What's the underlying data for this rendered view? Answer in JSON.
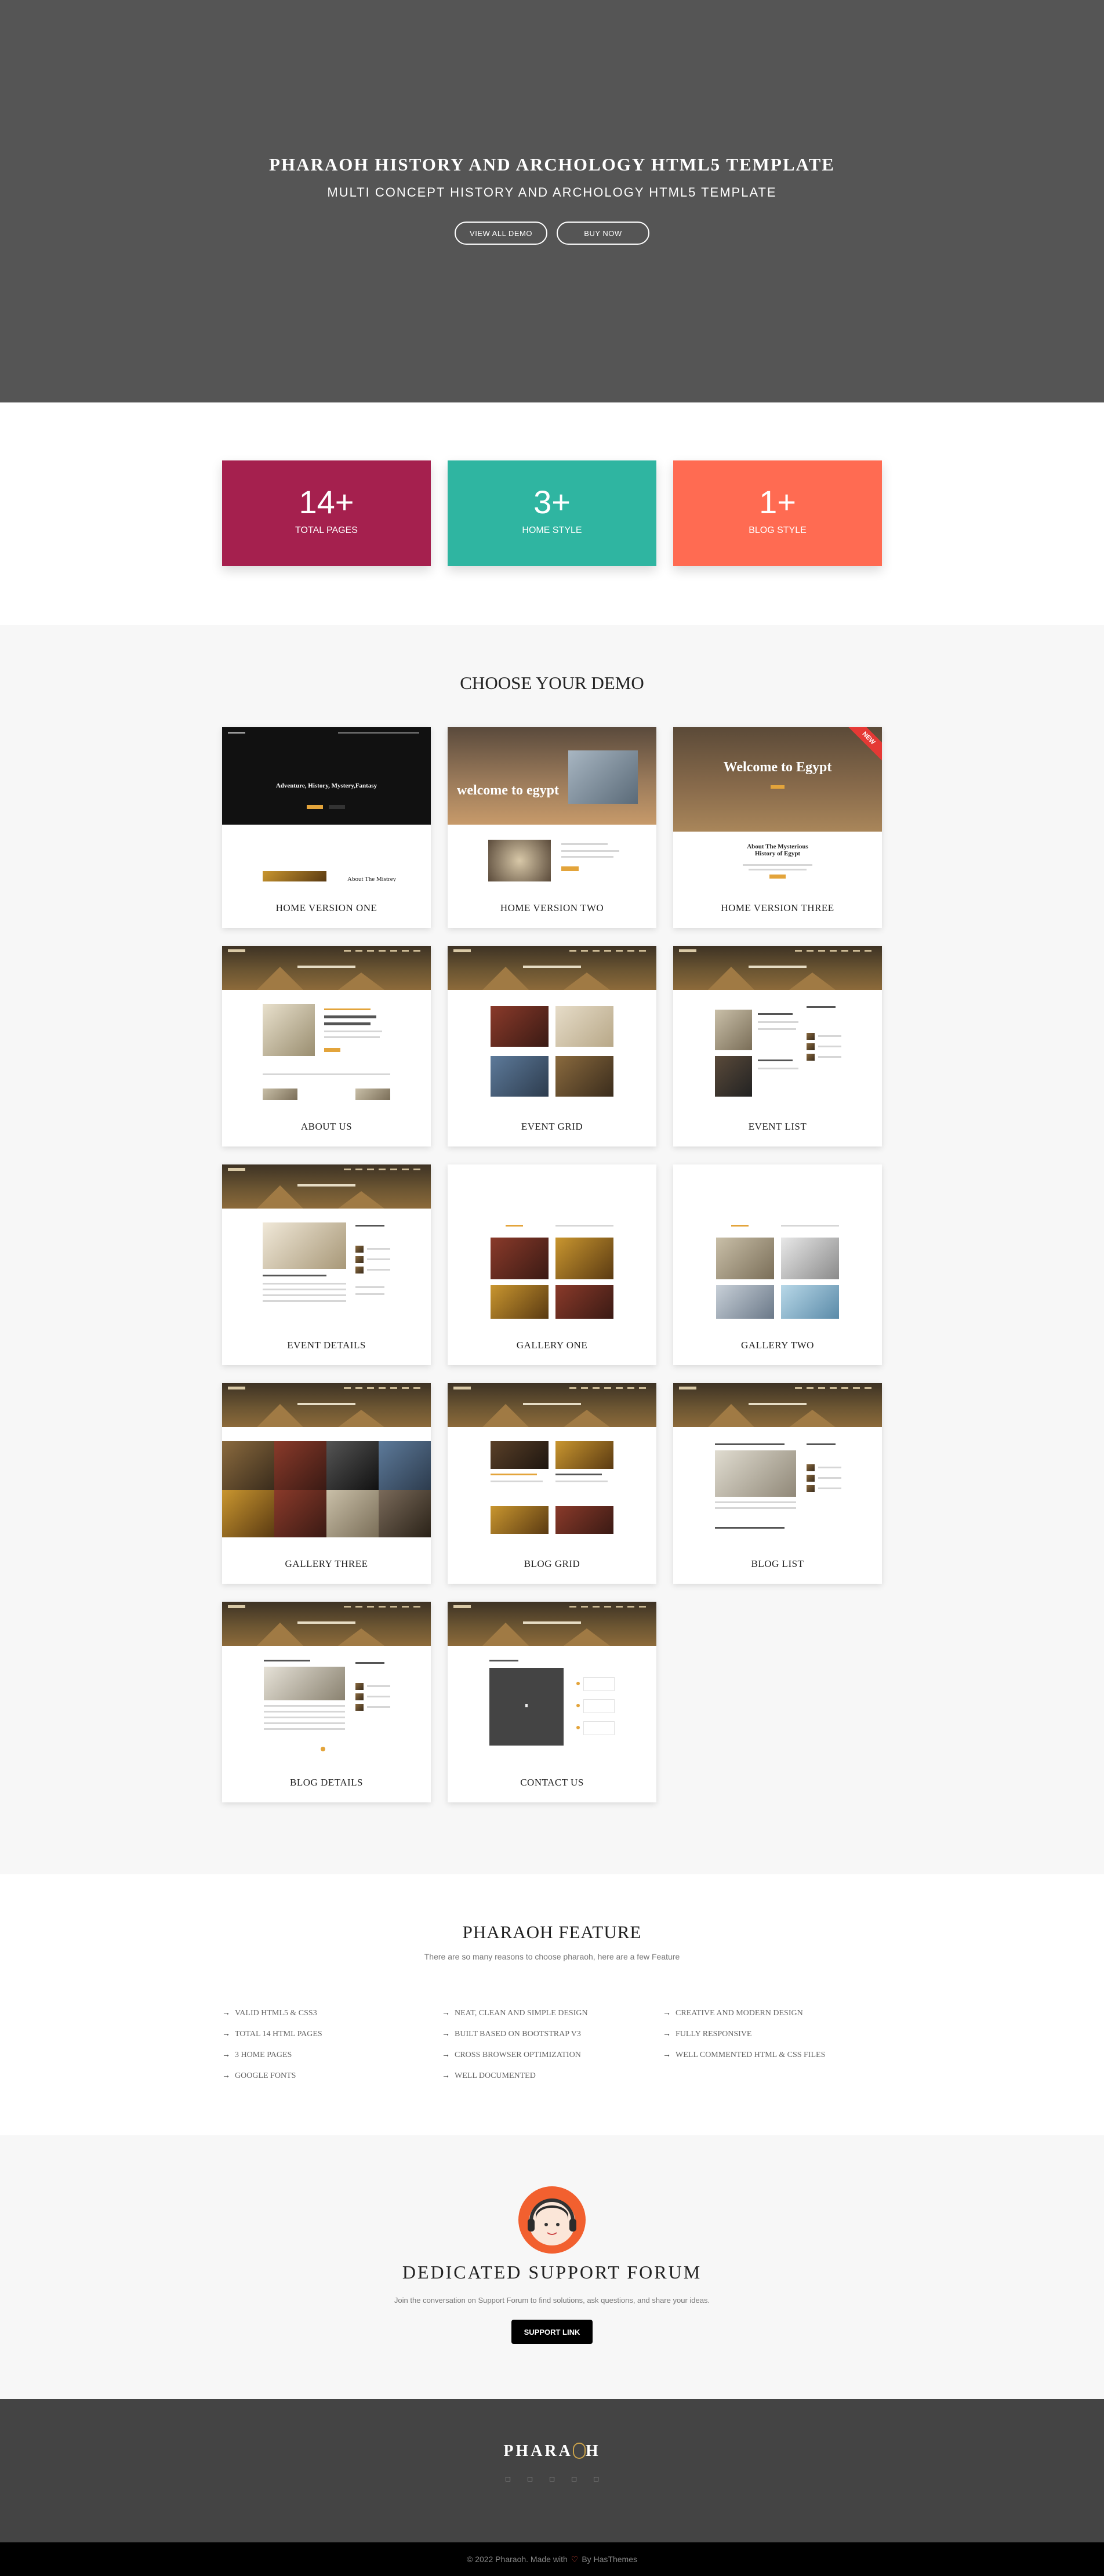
{
  "hero": {
    "title": "PHARAOH HISTORY AND ARCHOLOGY HTML5 TEMPLATE",
    "subtitle": "MULTI CONCEPT HISTORY AND ARCHOLOGY HTML5 TEMPLATE",
    "buttons": [
      "VIEW ALL DEMO",
      "BUY NOW"
    ]
  },
  "stats": [
    {
      "number": "14+",
      "label": "TOTAL PAGES",
      "color": "#a5204e"
    },
    {
      "number": "3+",
      "label": "HOME STYLE",
      "color": "#2fb5a1"
    },
    {
      "number": "1+",
      "label": "BLOG STYLE",
      "color": "#ff6b52"
    }
  ],
  "demos": {
    "title": "CHOOSE YOUR DEMO",
    "new_badge": "NEW",
    "home1_text": "Adventure, History, Mystery,Fantasy",
    "home1_about": "About The Mistrey",
    "home2_text": "welcome to egypt",
    "home3_text": "Welcome to Egypt",
    "home3_about": "About The Mysterious History of Egypt",
    "items": [
      "HOME VERSION ONE",
      "HOME VERSION TWO",
      "HOME VERSION THREE",
      "ABOUT US",
      "EVENT GRID",
      "EVENT LIST",
      "EVENT DETAILS",
      "GALLERY ONE",
      "GALLERY TWO",
      "GALLERY THREE",
      "BLOG GRID",
      "BLOG LIST",
      "BLOG DETAILS",
      "CONTACT US"
    ]
  },
  "features": {
    "title": "PHARAOH FEATURE",
    "subtitle": "There are so many reasons to choose pharaoh, here are a few Feature",
    "columns": [
      [
        "VALID HTML5 & CSS3",
        "TOTAL 14 HTML PAGES",
        "3 HOME PAGES",
        "GOOGLE FONTS"
      ],
      [
        "NEAT, CLEAN AND SIMPLE DESIGN",
        "BUILT BASED ON BOOTSTRAP V3",
        "CROSS BROWSER OPTIMIZATION",
        "WELL DOCUMENTED"
      ],
      [
        "CREATIVE AND MODERN DESIGN",
        "FULLY RESPONSIVE",
        "WELL COMMENTED HTML & CSS FILES"
      ]
    ]
  },
  "support": {
    "title": "DEDICATED SUPPORT FORUM",
    "subtitle": "Join the conversation on Support Forum to find solutions, ask questions, and share your ideas.",
    "button": "SUPPORT LINK"
  },
  "footer": {
    "logo_left": "PHARA",
    "logo_right": "H",
    "social_icons": [
      "facebook-icon",
      "twitter-icon",
      "google-plus-icon",
      "linkedin-icon",
      "pinterest-icon"
    ],
    "copyright_left": "© 2022 Pharaoh. Made with",
    "copyright_right": "By HasThemes"
  }
}
